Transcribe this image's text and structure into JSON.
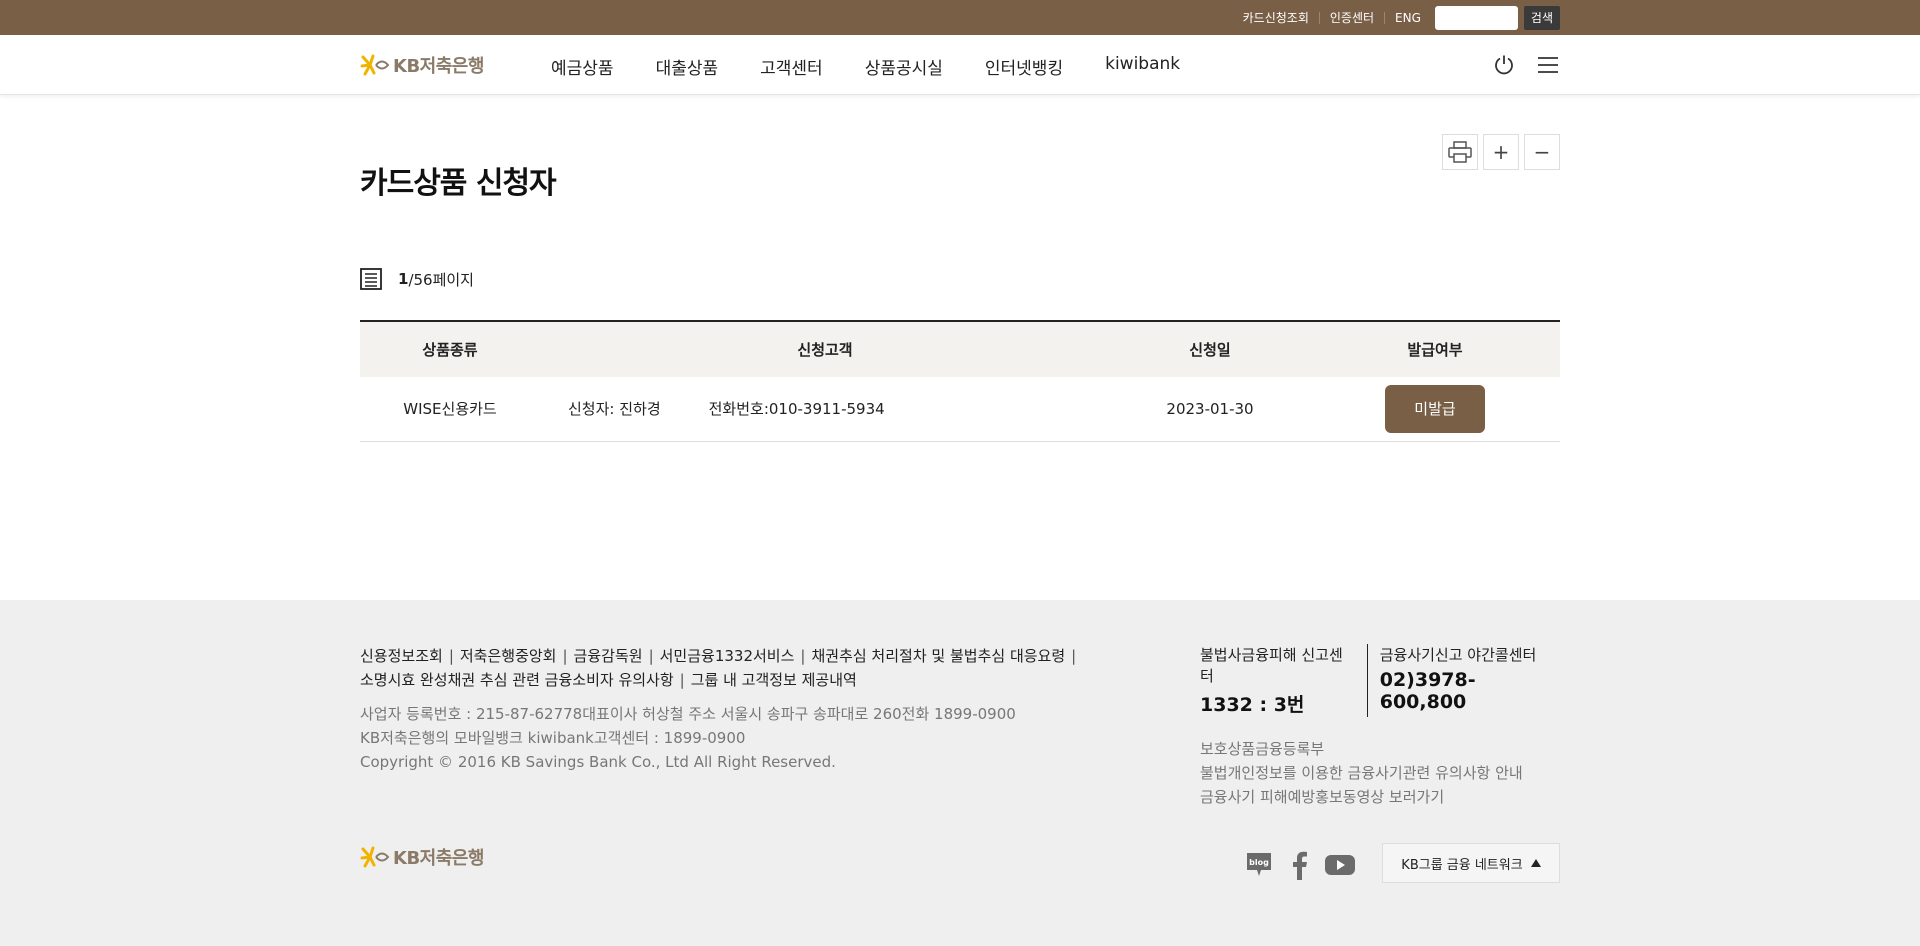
{
  "topbar": {
    "links": [
      "카드신청조회",
      "인증센터",
      "ENG"
    ],
    "search_placeholder": "",
    "search_button": "검색"
  },
  "header": {
    "logo_text": "KB저축은행",
    "nav": [
      "예금상품",
      "대출상품",
      "고객센터",
      "상품공시실",
      "인터넷뱅킹",
      "kiwibank"
    ]
  },
  "main": {
    "title": "카드상품 신청자",
    "pageinfo": {
      "current": "1",
      "total": "/56페이지"
    },
    "table": {
      "headers": [
        "상품종류",
        "신청고객",
        "신청일",
        "발급여부"
      ],
      "rows": [
        {
          "product": "WISE신용카드",
          "applicant": "신청자: 진하경",
          "phone": "전화번호:010-3911-5934",
          "date": "2023-01-30",
          "status": "미발급"
        }
      ]
    }
  },
  "footer": {
    "links": [
      "신용정보조회",
      "저축은행중앙회",
      "금융감독원",
      "서민금융1332서비스",
      "채권추심 처리절차 및 불법추심 대응요령",
      "소명시효 완성채권 추심 관련 금융소비자 유의사항",
      "그룹 내 고객정보 제공내역"
    ],
    "info": [
      "사업자 등록번호 : 215-87-62778대표이사 허상철 주소 서울시 송파구 송파대로 260전화 1899-0900",
      "KB저축은행의 모바일뱅크 kiwibank고객센터 : 1899-0900",
      "Copyright © 2016 KB Savings Bank Co., Ltd All Right Reserved."
    ],
    "center1": {
      "label": "불법사금융피해 신고센터",
      "num": "1332 : 3번"
    },
    "center2": {
      "label": "금융사기신고 야간콜센터",
      "num": "02)3978-600,800"
    },
    "right_links": [
      "보호상품금융등록부",
      "불법개인정보를 이용한 금융사기관련 유의사항 안내",
      "금융사기 피해예방홍보동영상 보러가기"
    ],
    "logo_text": "KB저축은행",
    "network_label": "KB그룹 금융 네트워크"
  },
  "colors": {
    "brand_brown": "#7a5f47",
    "logo_yellow": "#f0b400"
  }
}
